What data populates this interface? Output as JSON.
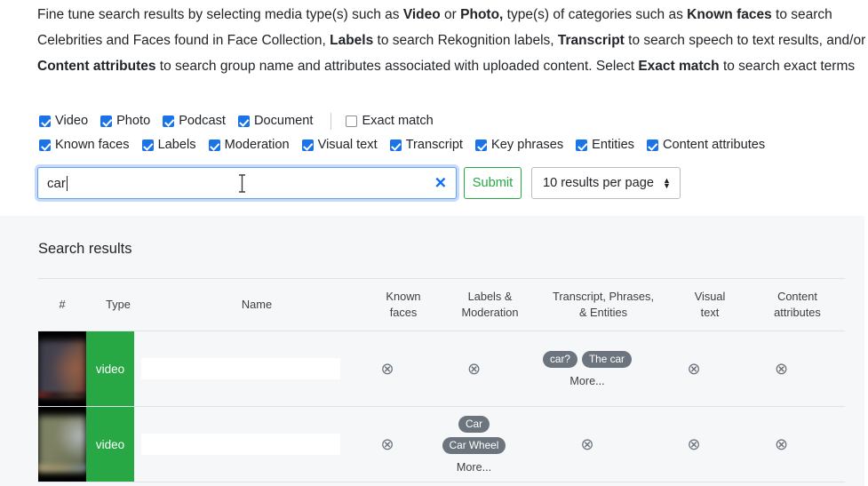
{
  "intro": {
    "segments": [
      {
        "t": "Fine tune search results by selecting media type(s) such as ",
        "b": false
      },
      {
        "t": "Video",
        "b": true
      },
      {
        "t": " or ",
        "b": false
      },
      {
        "t": "Photo,",
        "b": true
      },
      {
        "t": " type(s) of categories such as ",
        "b": false
      },
      {
        "t": "Known faces",
        "b": true
      },
      {
        "t": " to search Celebrities and Faces found in Face Collection, ",
        "b": false
      },
      {
        "t": "Labels",
        "b": true
      },
      {
        "t": " to search Rekognition labels, ",
        "b": false
      },
      {
        "t": "Transcript",
        "b": true
      },
      {
        "t": " to search speech to text results, and/or ",
        "b": false
      },
      {
        "t": "Content attributes",
        "b": true
      },
      {
        "t": " to search group name and attributes associated with uploaded content. Select ",
        "b": false
      },
      {
        "t": "Exact match",
        "b": true
      },
      {
        "t": " to search exact terms",
        "b": false
      }
    ]
  },
  "filters": {
    "row1": [
      {
        "label": "Video",
        "checked": true
      },
      {
        "label": "Photo",
        "checked": true
      },
      {
        "label": "Podcast",
        "checked": true
      },
      {
        "label": "Document",
        "checked": true
      }
    ],
    "exact_match": {
      "label": "Exact match",
      "checked": false
    },
    "row2": [
      {
        "label": "Known faces",
        "checked": true
      },
      {
        "label": "Labels",
        "checked": true
      },
      {
        "label": "Moderation",
        "checked": true
      },
      {
        "label": "Visual text",
        "checked": true
      },
      {
        "label": "Transcript",
        "checked": true
      },
      {
        "label": "Key phrases",
        "checked": true
      },
      {
        "label": "Entities",
        "checked": true
      },
      {
        "label": "Content attributes",
        "checked": true
      }
    ]
  },
  "search": {
    "value": "car",
    "placeholder": "",
    "clear_label": "✕",
    "submit_label": "Submit",
    "page_size_label": "10 results per page",
    "accent_focus": "#0d6efd",
    "submit_color": "#28a745"
  },
  "results": {
    "title": "Search results",
    "columns": [
      {
        "key": "num",
        "label": "#"
      },
      {
        "key": "type",
        "label": "Type"
      },
      {
        "key": "name",
        "label": "Name"
      },
      {
        "key": "faces",
        "label": "Known\nfaces"
      },
      {
        "key": "labels",
        "label": "Labels &\nModeration"
      },
      {
        "key": "transcript",
        "label": "Transcript, Phrases,\n& Entities"
      },
      {
        "key": "visual",
        "label": "Visual\ntext"
      },
      {
        "key": "attrs",
        "label": "Content\nattributes"
      }
    ],
    "empty_icon": "circle-x-icon",
    "more_label": "More...",
    "rows": [
      {
        "type": "video",
        "name": "",
        "faces": [],
        "labels": [],
        "transcript": [
          "car?",
          "The car"
        ],
        "transcript_more": true,
        "labels_more": false,
        "visual": [],
        "attrs": []
      },
      {
        "type": "video",
        "name": "",
        "faces": [],
        "labels": [
          "Car",
          "Car Wheel"
        ],
        "labels_more": true,
        "transcript": [],
        "transcript_more": false,
        "visual": [],
        "attrs": []
      }
    ]
  }
}
